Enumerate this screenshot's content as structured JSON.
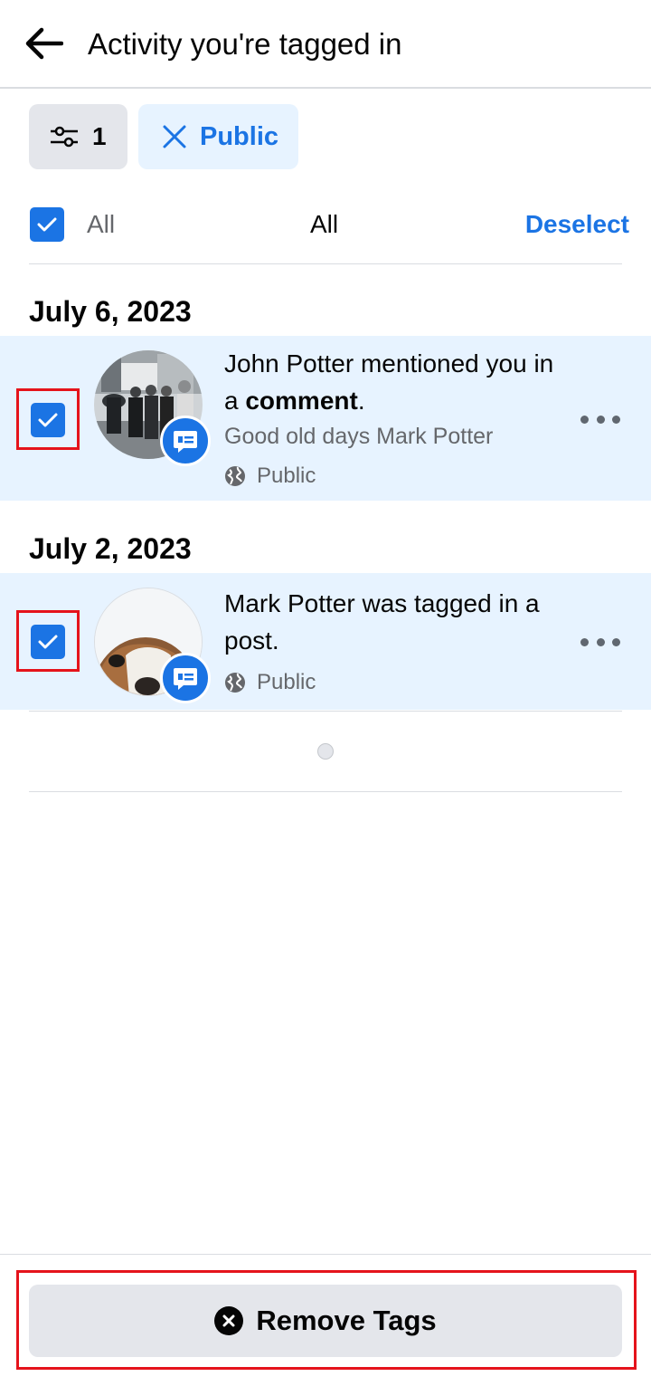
{
  "header": {
    "title": "Activity you're tagged in"
  },
  "filters": {
    "filter_count": "1",
    "public_chip": "Public"
  },
  "select_row": {
    "all_left": "All",
    "all_center": "All",
    "deselect": "Deselect"
  },
  "sections": [
    {
      "date": "July 6, 2023",
      "item": {
        "text_start": "John Potter mentioned you in a ",
        "text_bold": "comment",
        "text_end": ".",
        "subtext": "Good old days Mark Potter",
        "privacy": "Public",
        "checked": true
      }
    },
    {
      "date": "July 2, 2023",
      "item": {
        "text": "Mark Potter was tagged in a post.",
        "privacy": "Public",
        "checked": true
      }
    }
  ],
  "bottom": {
    "remove_label": "Remove Tags"
  },
  "colors": {
    "accent": "#1b74e4",
    "selected_bg": "#e7f3ff",
    "annotation": "#e5131b"
  }
}
